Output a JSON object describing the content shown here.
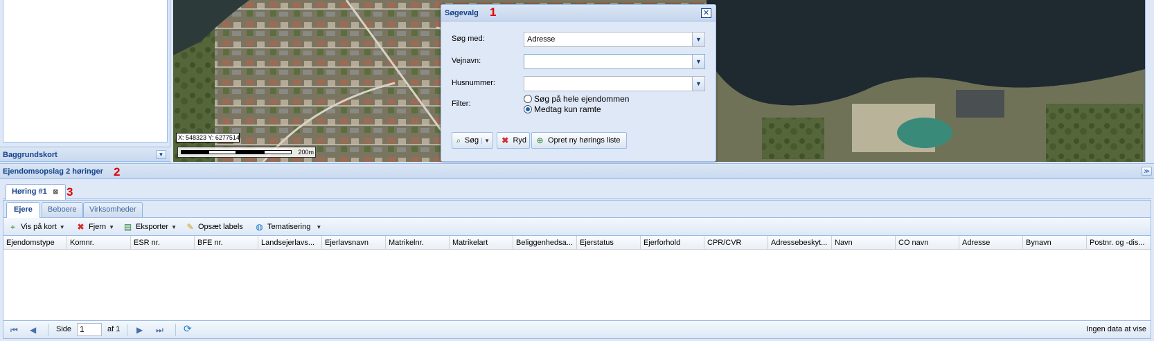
{
  "left_panel": {
    "title": "Baggrundskort"
  },
  "map": {
    "coordinates": "X: 548323 Y: 6277514",
    "scale_label": "200m"
  },
  "dialog": {
    "title": "Søgevalg",
    "fields": {
      "search_by_label": "Søg med:",
      "search_by_value": "Adresse",
      "street_label": "Vejnavn:",
      "street_value": "",
      "house_label": "Husnummer:",
      "house_value": "",
      "filter_label": "Filter:"
    },
    "radios": [
      {
        "label": "Søg på hele ejendommen",
        "checked": false
      },
      {
        "label": "Medtag kun ramte",
        "checked": true
      }
    ],
    "buttons": {
      "search": "Søg",
      "clear": "Ryd",
      "create_list": "Opret ny hørings liste"
    }
  },
  "annotations": [
    "1",
    "2",
    "3"
  ],
  "section": {
    "title": "Ejendomsopslag 2 høringer",
    "outer_tab": "Høring #1",
    "inner_tabs": [
      "Ejere",
      "Beboere",
      "Virksomheder"
    ]
  },
  "toolbar": {
    "show_on_map": "Vis på kort",
    "remove": "Fjern",
    "export": "Eksporter",
    "labels": "Opsæt labels",
    "thematize": "Tematisering"
  },
  "grid": {
    "columns": [
      "Ejendomstype",
      "Komnr.",
      "ESR nr.",
      "BFE nr.",
      "Landsejerlavs...",
      "Ejerlavsnavn",
      "Matrikelnr.",
      "Matrikelart",
      "Beliggenhedsa...",
      "Ejerstatus",
      "Ejerforhold",
      "CPR/CVR",
      "Adressebeskyt...",
      "Navn",
      "CO navn",
      "Adresse",
      "Bynavn",
      "Postnr. og -dis..."
    ],
    "rows": []
  },
  "paging": {
    "page_label": "Side",
    "page_value": "1",
    "of_label": "af 1",
    "empty_text": "Ingen data at vise"
  }
}
